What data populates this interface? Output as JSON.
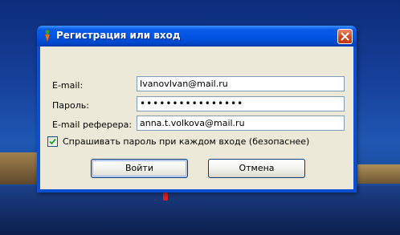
{
  "dialog": {
    "title": "Регистрация или вход",
    "email_label": "E-mail:",
    "email_value": "IvanovIvan@mail.ru",
    "password_label": "Пароль:",
    "password_value": "••••••••••••••••",
    "referrer_label": "E-mail реферера:",
    "referrer_value": "anna.t.volkova@mail.ru",
    "checkbox_label": "Спрашивать пароль при каждом входе (безопаснее)",
    "checkbox_checked": true,
    "login_button": "Войти",
    "cancel_button": "Отмена"
  },
  "colors": {
    "titlebar": "#0054e3",
    "client_bg": "#ece9d8",
    "close_button": "#d0451f",
    "field_border": "#7f9db9"
  },
  "icons": {
    "app": "carrot-icon",
    "close": "close-icon",
    "check": "check-icon"
  }
}
